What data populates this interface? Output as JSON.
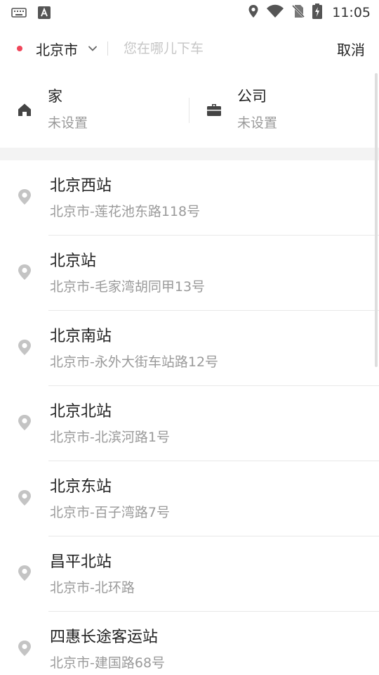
{
  "status_bar": {
    "time": "11:05",
    "left_icons": [
      "keyboard-icon",
      "a-notification-icon"
    ],
    "right_icons": [
      "location-icon",
      "wifi-icon",
      "no-sim-icon",
      "battery-charging-icon"
    ]
  },
  "search": {
    "city": "北京市",
    "placeholder": "您在哪儿下车",
    "value": "",
    "cancel_label": "取消",
    "dot_color": "#f0465a"
  },
  "quick": {
    "home": {
      "title": "家",
      "subtitle": "未设置",
      "icon": "home-icon"
    },
    "company": {
      "title": "公司",
      "subtitle": "未设置",
      "icon": "briefcase-icon"
    }
  },
  "pois": [
    {
      "name": "北京西站",
      "address": "北京市-莲花池东路118号"
    },
    {
      "name": "北京站",
      "address": "北京市-毛家湾胡同甲13号"
    },
    {
      "name": "北京南站",
      "address": "北京市-永外大街车站路12号"
    },
    {
      "name": "北京北站",
      "address": "北京市-北滨河路1号"
    },
    {
      "name": "北京东站",
      "address": "北京市-百子湾路7号"
    },
    {
      "name": "昌平北站",
      "address": "北京市-北环路"
    },
    {
      "name": "四惠长途客运站",
      "address": "北京市-建国路68号"
    }
  ]
}
